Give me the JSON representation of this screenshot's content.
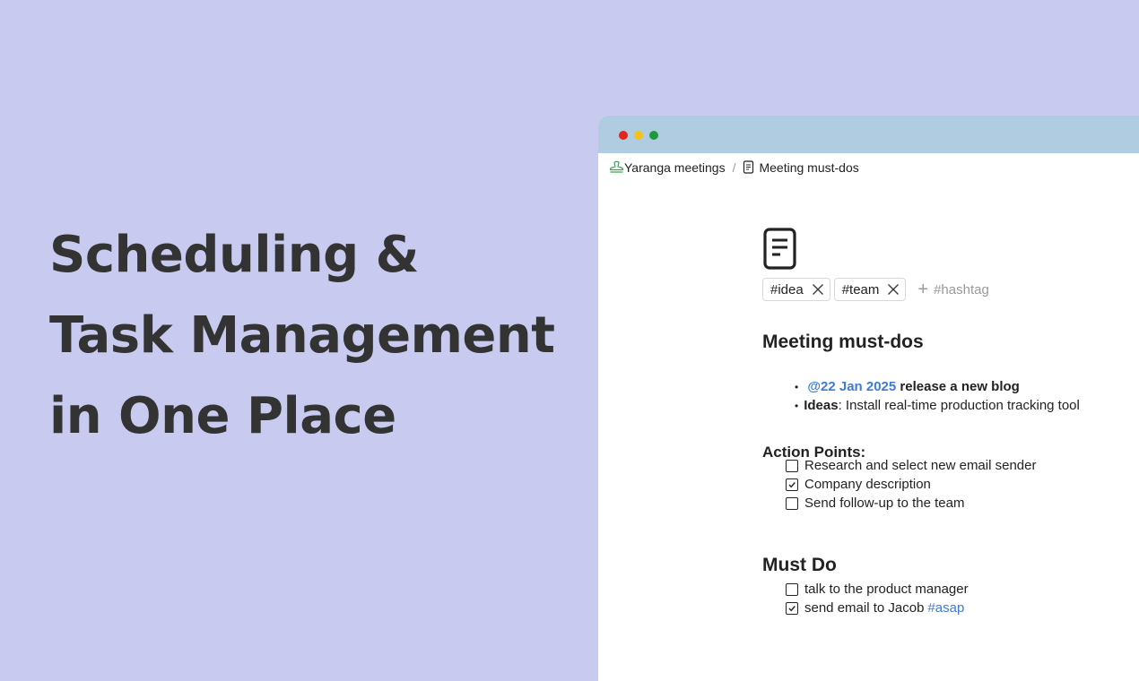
{
  "hero": {
    "lines": [
      "Scheduling &",
      "Task Management",
      "in One Place"
    ]
  },
  "breadcrumb": {
    "workspace": "Yaranga meetings",
    "separator": "/",
    "page": "Meeting must-dos"
  },
  "tags": {
    "items": [
      "#idea",
      "#team"
    ],
    "add_placeholder": "#hashtag"
  },
  "doc": {
    "title": "Meeting must-dos",
    "bullets": [
      {
        "mention": "@22 Jan 2025",
        "bold_text": "release a new blog"
      },
      {
        "label": "Ideas",
        "text": ": Install real-time production tracking tool"
      }
    ],
    "action_points": {
      "heading": "Action Points:",
      "items": [
        {
          "text": "Research and select new email sender",
          "checked": false
        },
        {
          "text": "Company description",
          "checked": true
        },
        {
          "text": "Send follow-up to the team",
          "checked": false
        }
      ]
    },
    "must_do": {
      "heading": "Must Do",
      "items": [
        {
          "text": "talk to the product manager",
          "checked": false
        },
        {
          "text": "send email to Jacob",
          "hashtag": "#asap",
          "checked": true
        }
      ]
    }
  },
  "colors": {
    "background": "#c8caf0",
    "titlebar": "#b0cce0",
    "link": "#3e7bd8"
  }
}
